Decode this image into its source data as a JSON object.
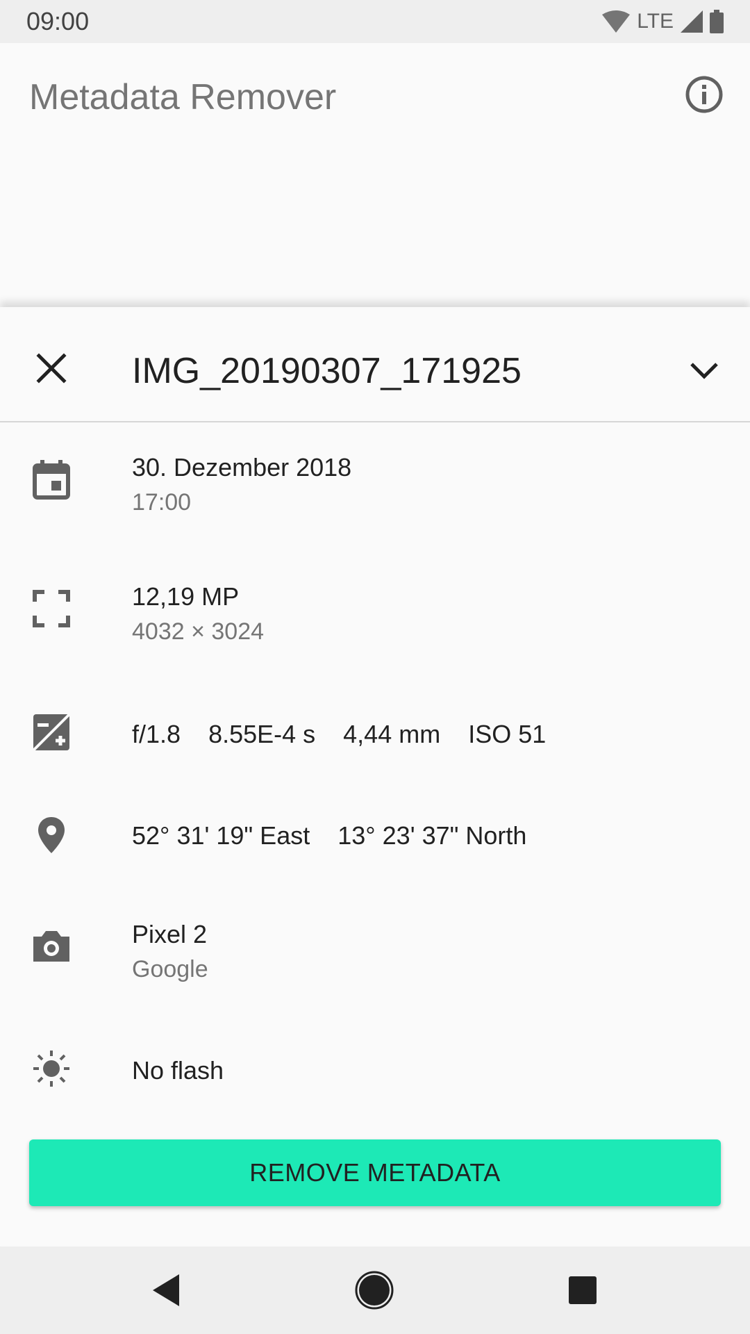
{
  "status_bar": {
    "time": "09:00",
    "network": "LTE"
  },
  "app_bar": {
    "title": "Metadata Remover"
  },
  "sheet": {
    "file_name": "IMG_20190307_171925",
    "rows": {
      "date": {
        "primary": "30. Dezember 2018",
        "secondary": "17:00"
      },
      "resolution": {
        "primary": "12,19 MP",
        "secondary": "4032 × 3024"
      },
      "exposure": {
        "aperture": "f/1.8",
        "shutter": "8.55E-4 s",
        "focal": "4,44 mm",
        "iso": "ISO 51"
      },
      "location": {
        "lat": "52° 31' 19\" East",
        "lon": "13° 23' 37\" North"
      },
      "camera": {
        "primary": "Pixel 2",
        "secondary": "Google"
      },
      "flash": {
        "primary": "No flash"
      }
    },
    "remove_button": "REMOVE METADATA"
  },
  "colors": {
    "accent": "#1de9b6",
    "icon": "#616161",
    "text_secondary": "#757575"
  }
}
